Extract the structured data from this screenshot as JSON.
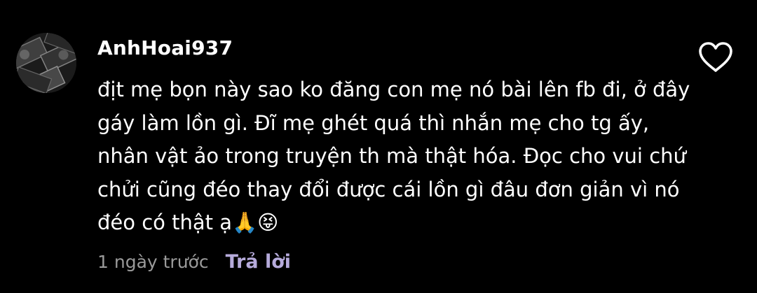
{
  "comment": {
    "author": "AnhHoai937",
    "avatar_icon": "money-avatar",
    "lines": [
      "địt mẹ bọn này sao ko đăng con mẹ nó bài lên fb đi, ở đây",
      "gáy làm lồn gì. Đĩ mẹ ghét quá thì nhắn mẹ cho tg ấy,",
      "nhân vật ảo trong truyện th mà thật hóa. Đọc cho vui chứ",
      "chửi cũng đéo thay đổi được cái lồn gì đâu đơn giản vì nó",
      "đéo có thật ạ🙏😝"
    ],
    "timestamp": "1 ngày trước",
    "reply_label": "Trả lời",
    "like_icon": "heart-outline-icon"
  },
  "colors": {
    "background": "#000000",
    "text": "#ffffff",
    "muted": "#9a9a9a",
    "reply": "#b6abdb"
  }
}
